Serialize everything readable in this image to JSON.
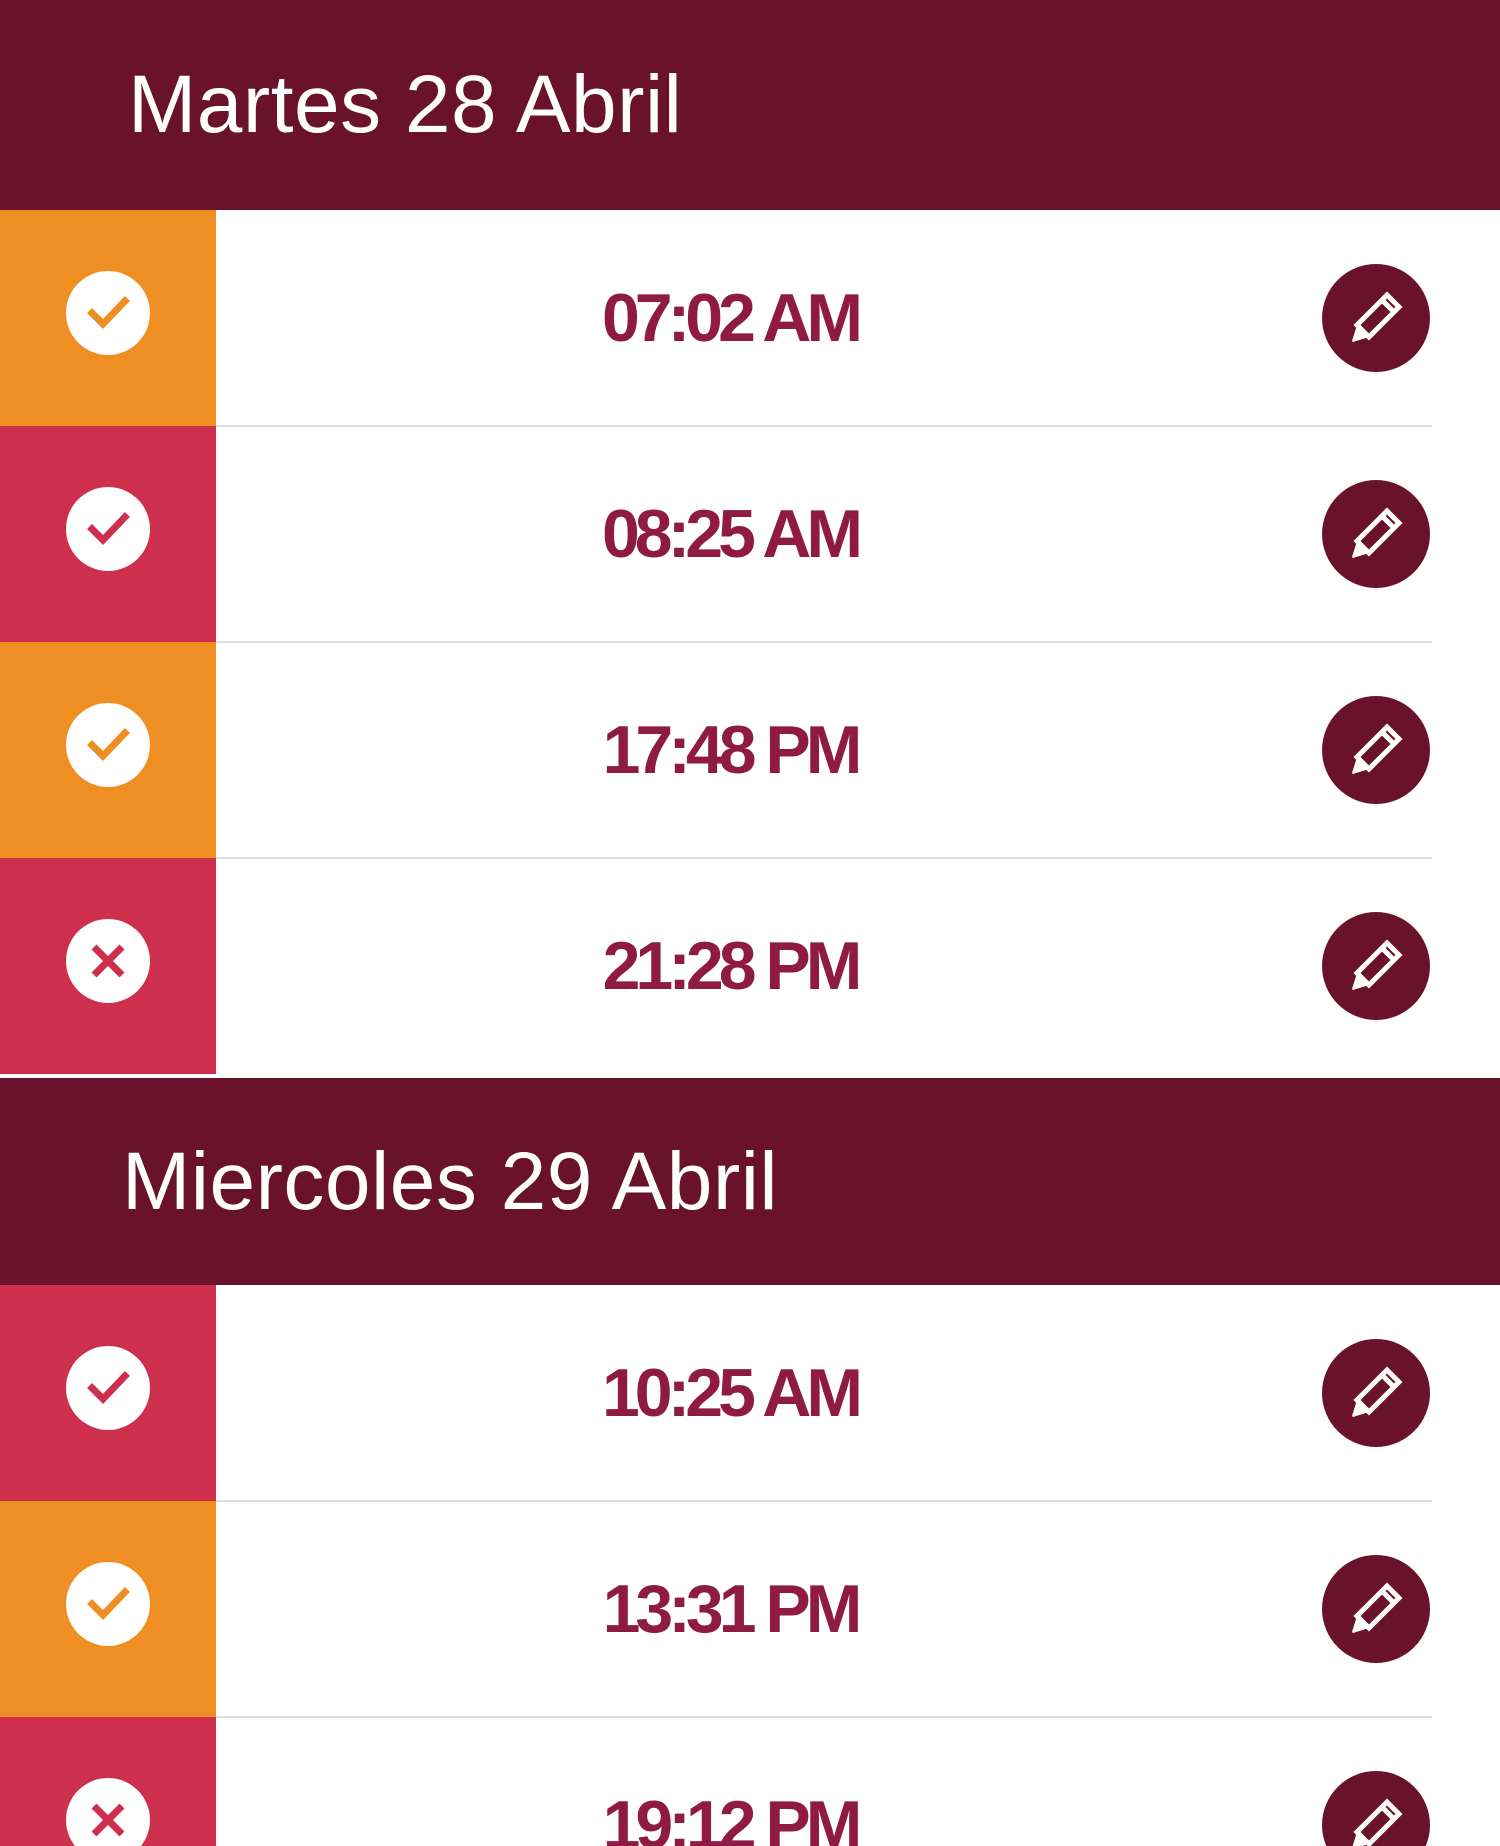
{
  "colors": {
    "header_bg": "#6a122c",
    "edit_button_bg": "#6a122c",
    "time_text": "#8f1a44",
    "status_orange": "#ef8e23",
    "status_red": "#ce2f4c",
    "divider": "#dedede"
  },
  "days": [
    {
      "title": "Martes 28 Abril",
      "entries": [
        {
          "time": "07:02 AM",
          "status": "check",
          "color": "orange",
          "edit_icon": "pencil-icon"
        },
        {
          "time": "08:25 AM",
          "status": "check",
          "color": "red",
          "edit_icon": "pencil-icon"
        },
        {
          "time": "17:48 PM",
          "status": "check",
          "color": "orange",
          "edit_icon": "pencil-icon"
        },
        {
          "time": "21:28 PM",
          "status": "cross",
          "color": "red",
          "edit_icon": "pencil-icon"
        }
      ]
    },
    {
      "title": "Miercoles 29 Abril",
      "entries": [
        {
          "time": "10:25 AM",
          "status": "check",
          "color": "red",
          "edit_icon": "pencil-icon"
        },
        {
          "time": "13:31 PM",
          "status": "check",
          "color": "orange",
          "edit_icon": "pencil-icon"
        },
        {
          "time": "19:12 PM",
          "status": "cross",
          "color": "red",
          "edit_icon": "pencil-icon"
        }
      ]
    }
  ]
}
